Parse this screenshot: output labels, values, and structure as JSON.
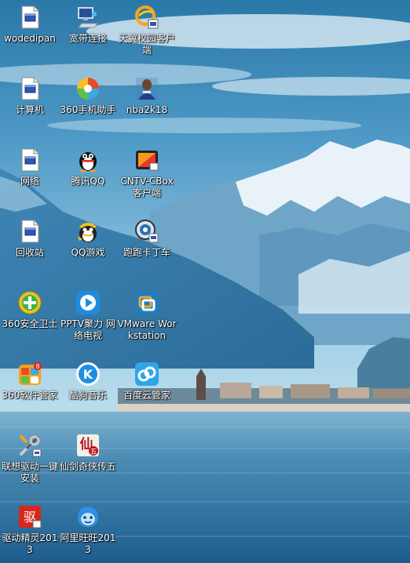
{
  "desktop": {
    "icons": [
      {
        "label": "wodedipan",
        "icon": "document-icon"
      },
      {
        "label": "宽带连接",
        "icon": "network-computer-icon"
      },
      {
        "label": "天翼校园客户端",
        "icon": "campus-client-icon"
      },
      {
        "label": "计算机",
        "icon": "document-icon"
      },
      {
        "label": "360手机助手",
        "icon": "360-mobile-icon"
      },
      {
        "label": "nba2k18",
        "icon": "player-photo-icon"
      },
      {
        "label": "网络",
        "icon": "document-icon"
      },
      {
        "label": "腾讯QQ",
        "icon": "qq-penguin-icon"
      },
      {
        "label": "CNTV-CBox客户端",
        "icon": "cbox-icon"
      },
      {
        "label": "回收站",
        "icon": "document-icon"
      },
      {
        "label": "QQ游戏",
        "icon": "qq-game-icon"
      },
      {
        "label": "跑跑卡丁车",
        "icon": "kart-rider-icon"
      },
      {
        "label": "360安全卫士",
        "icon": "360-security-icon"
      },
      {
        "label": "PPTV聚力 网络电视",
        "icon": "pptv-icon"
      },
      {
        "label": "VMware Workstation",
        "icon": "vmware-icon"
      },
      {
        "label": "360软件管家",
        "icon": "360-software-icon"
      },
      {
        "label": "酷狗音乐",
        "icon": "kugou-icon"
      },
      {
        "label": "百度云管家",
        "icon": "baidu-cloud-icon"
      },
      {
        "label": "联想驱动一键安装",
        "icon": "wrench-screwdriver-icon"
      },
      {
        "label": "仙剑奇侠传五",
        "icon": "xianjian-icon"
      },
      {
        "label": "驱动精灵2013",
        "icon": "driver-genius-icon"
      },
      {
        "label": "阿里旺旺2013",
        "icon": "aliwangwang-icon"
      }
    ]
  }
}
